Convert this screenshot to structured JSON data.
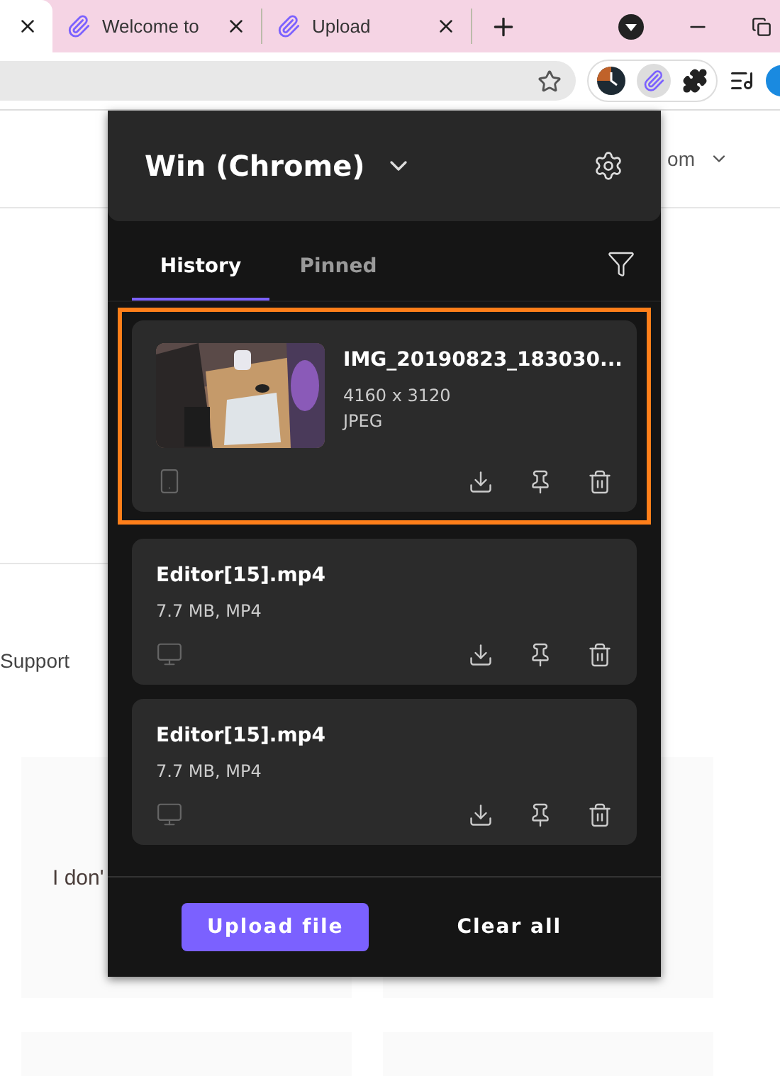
{
  "browser": {
    "tabs": [
      {
        "selected": true
      },
      {
        "title": "Welcome to",
        "selected": false
      },
      {
        "title": "Upload",
        "selected": false
      }
    ]
  },
  "page": {
    "header_link": "om",
    "side_text": "Support",
    "card_text": "I don'"
  },
  "popup": {
    "device": "Win (Chrome)",
    "tabs": [
      {
        "label": "History",
        "selected": true
      },
      {
        "label": "Pinned",
        "selected": false
      }
    ],
    "items": [
      {
        "name": "IMG_20190823_183030...",
        "details": [
          "4160 x 3120",
          "JPEG"
        ],
        "source": {
          "kind": "phone"
        },
        "highlighted": true
      },
      {
        "kind": "file",
        "name": "Editor[15].mp4",
        "details": [
          "7.7 MB, MP4"
        ],
        "source": {
          "kind": "desktop"
        },
        "highlighted": false
      },
      {
        "kind": "file",
        "name": "Editor[15].mp4",
        "details": [
          "7.7 MB, MP4"
        ],
        "source": {
          "kind": "desktop"
        },
        "highlighted": false
      }
    ],
    "buttons": [
      {
        "label": "Upload file",
        "kind": "primary"
      },
      {
        "label": "Clear all",
        "kind": "plain"
      }
    ]
  }
}
